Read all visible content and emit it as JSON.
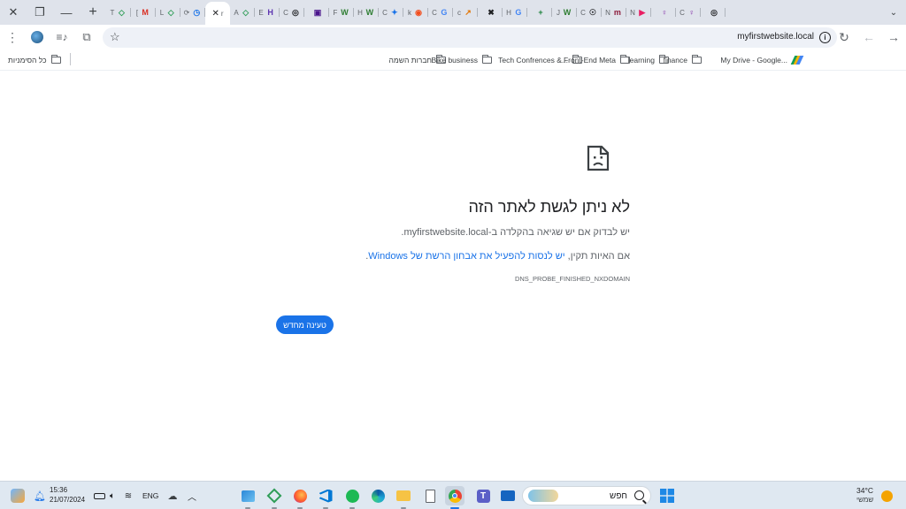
{
  "browser": {
    "tabs": [
      {
        "letter": "T",
        "color": "#2e9d57",
        "glyph": "◇"
      },
      {
        "letter": "[",
        "color": "#d93025",
        "glyph": "M"
      },
      {
        "letter": "L",
        "color": "#2e9d57",
        "glyph": "◇"
      },
      {
        "letter": "⟳",
        "color": "#1a73e8",
        "glyph": "◷"
      },
      {
        "letter": "r",
        "color": "#1a73e8",
        "glyph": ""
      },
      {
        "letter": "A",
        "color": "#2e9d57",
        "glyph": "◇"
      },
      {
        "letter": "E",
        "color": "#5e35b1",
        "glyph": "H"
      },
      {
        "letter": "C",
        "color": "#202124",
        "glyph": "◎"
      },
      {
        "letter": "",
        "color": "#4a148c",
        "glyph": "▣"
      },
      {
        "letter": "F",
        "color": "#2e7d32",
        "glyph": "W"
      },
      {
        "letter": "H",
        "color": "#2e7d32",
        "glyph": "W"
      },
      {
        "letter": "C",
        "color": "#1a73e8",
        "glyph": "✦"
      },
      {
        "letter": "k",
        "color": "#f24e1e",
        "glyph": "◉"
      },
      {
        "letter": "C",
        "color": "#4285f4",
        "glyph": "G"
      },
      {
        "letter": "c",
        "color": "#e37400",
        "glyph": "↗"
      },
      {
        "letter": "",
        "color": "#202124",
        "glyph": "✖"
      },
      {
        "letter": "H",
        "color": "#4285f4",
        "glyph": "G"
      },
      {
        "letter": "",
        "color": "#188038",
        "glyph": "+"
      },
      {
        "letter": "J",
        "color": "#2e7d32",
        "glyph": "W"
      },
      {
        "letter": "C",
        "color": "#202124",
        "glyph": "☉"
      },
      {
        "letter": "N",
        "color": "#8b1a3a",
        "glyph": "m"
      },
      {
        "letter": "N",
        "color": "#e91e63",
        "glyph": "▶"
      },
      {
        "letter": "",
        "color": "#7b1fa2",
        "glyph": "♀"
      },
      {
        "letter": "C",
        "color": "#7b1fa2",
        "glyph": "♀"
      },
      {
        "letter": "",
        "color": "#202124",
        "glyph": "◎"
      }
    ],
    "active_tab_index": 4,
    "url": "myfirstwebsite.local"
  },
  "bookmarks": {
    "all_bookmarks": "כל הסימניות",
    "items": [
      {
        "label": "חברות השמה",
        "type": "folder"
      },
      {
        "label": "Bike business",
        "type": "folder"
      },
      {
        "label": "Tech Confrences &...",
        "type": "folder"
      },
      {
        "label": "Front-End Meta",
        "type": "folder"
      },
      {
        "label": "learning",
        "type": "folder"
      },
      {
        "label": "finance",
        "type": "folder"
      },
      {
        "label": "My Drive - Google...",
        "type": "drive"
      }
    ]
  },
  "error": {
    "title": "לא ניתן לגשת לאתר הזה",
    "line1": "יש לבדוק אם יש שגיאה בהקלדה ב-myfirstwebsite.local.",
    "line2_prefix": "אם האיות תקין, ",
    "line2_link": "יש לנסות להפעיל את אבחון הרשת של Windows",
    "line2_suffix": ".",
    "code": "DNS_PROBE_FINISHED_NXDOMAIN",
    "reload_label": "טעינה מחדש"
  },
  "taskbar": {
    "search_placeholder": "חפש",
    "weather_temp": "34°C",
    "weather_desc": "שמשי",
    "time": "15:36",
    "date": "21/07/2024",
    "language": "ENG"
  },
  "colors": {
    "accent": "#1a73e8",
    "tabstrip": "#dfe3eb",
    "taskbar": "#dfe8f1"
  }
}
